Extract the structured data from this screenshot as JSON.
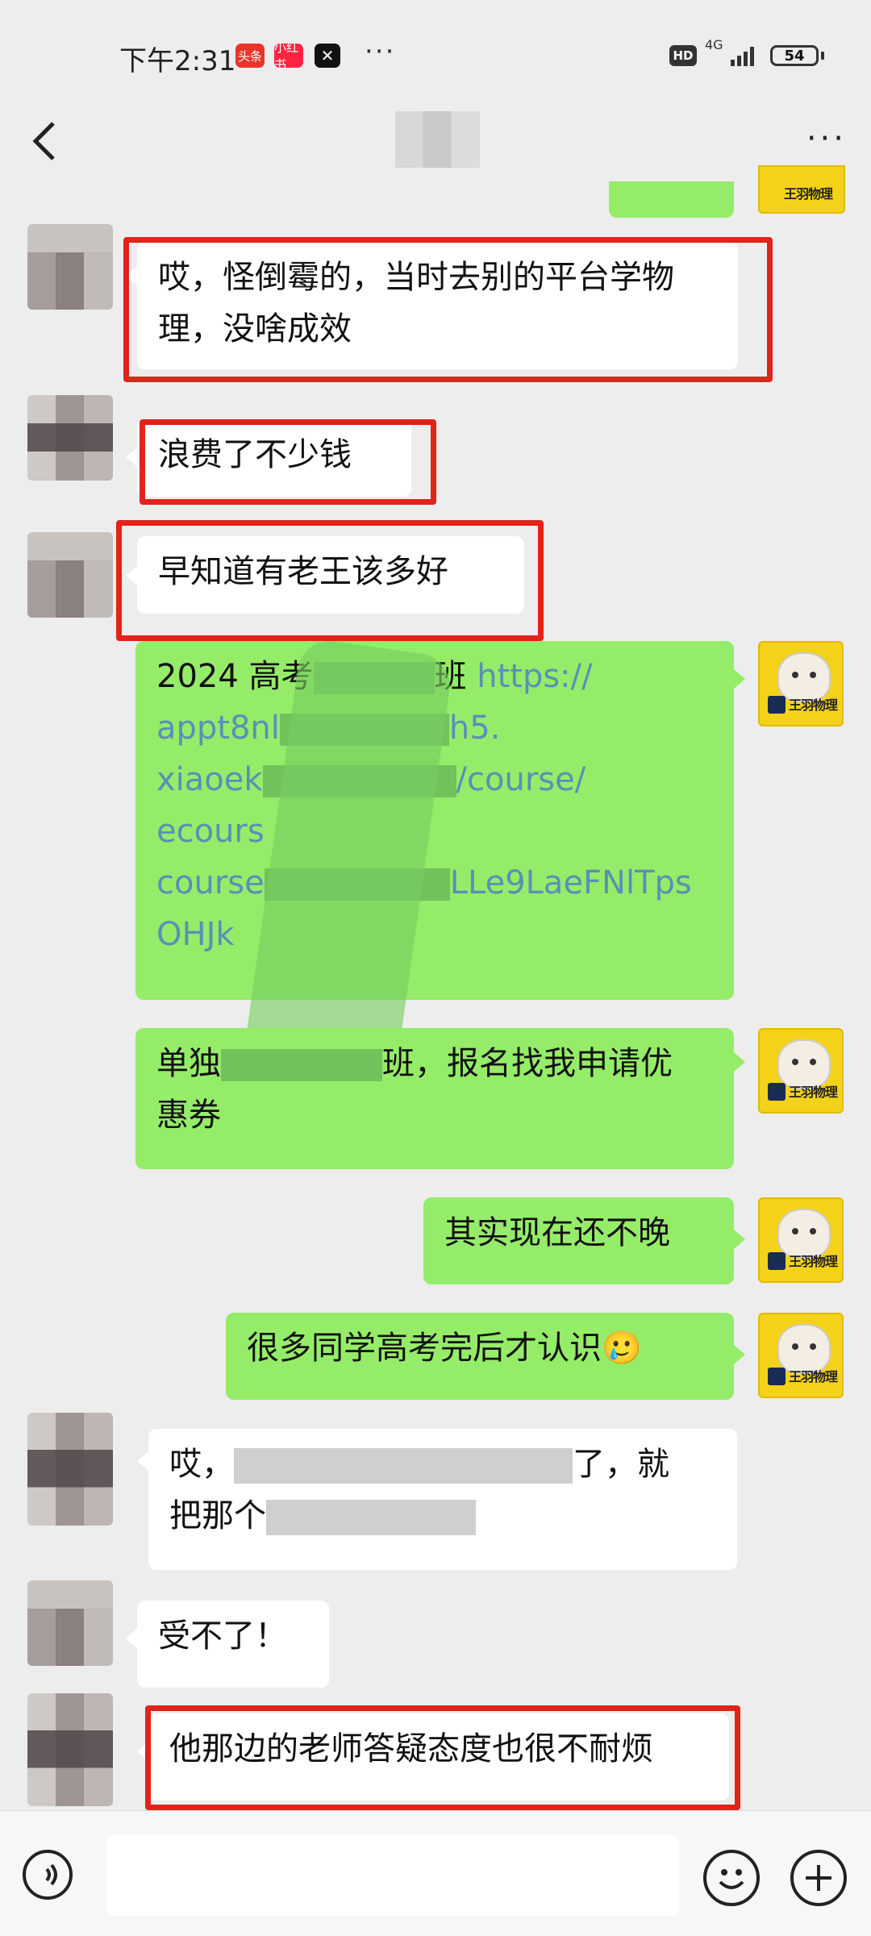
{
  "status_bar": {
    "time": "下午2:31",
    "app_badges": [
      "头条",
      "小红书"
    ],
    "more_dots": "···",
    "hd": "HD",
    "network": "4G",
    "battery": "54"
  },
  "nav": {
    "title": "",
    "more": "···"
  },
  "messages": [
    {
      "side": "right",
      "text": ""
    },
    {
      "side": "left",
      "text": "哎，怪倒霉的，当时去别的平台学物理，没啥成效",
      "highlighted": true
    },
    {
      "side": "left",
      "text": "浪费了不少钱",
      "highlighted": true
    },
    {
      "side": "left",
      "text": "早知道有老王该多好",
      "highlighted": true
    },
    {
      "side": "right",
      "text_prefix": "2024 高考",
      "text_suffix": "班 ",
      "link_lines": [
        "https://",
        "appt8nl",
        "h5.",
        "xiaoek",
        "/course/",
        "ecours",
        "course",
        "LLe9LaeFNlTps",
        "OHJk"
      ]
    },
    {
      "side": "right",
      "text": "单独",
      "text2": "班，报名找我申请优",
      "text3": "惠券"
    },
    {
      "side": "right",
      "text": "其实现在还不晚"
    },
    {
      "side": "right",
      "text": "很多同学高考完后才认识🥲"
    },
    {
      "side": "left",
      "text": "哎，",
      "text2": "了，就",
      "text3": "把那个"
    },
    {
      "side": "left",
      "text": "受不了！"
    },
    {
      "side": "left",
      "text": "他那边的老师答疑态度也很不耐烦",
      "highlighted": true
    }
  ],
  "avatar": {
    "brand_text": "王羽物理"
  },
  "input_bar": {
    "placeholder": ""
  },
  "colors": {
    "bubble_right": "#95ec69",
    "bubble_left": "#ffffff",
    "highlight": "#e2231a",
    "background": "#ededed"
  }
}
